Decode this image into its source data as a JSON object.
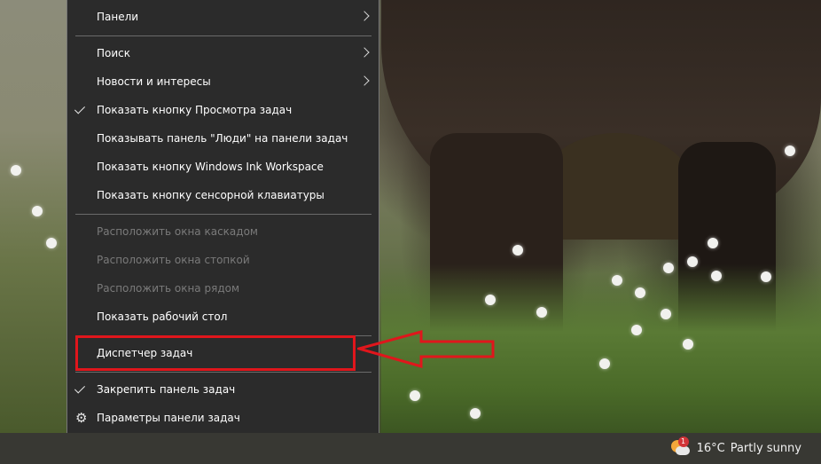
{
  "context_menu": {
    "items": [
      {
        "label": "Панели",
        "submenu": true
      },
      {
        "label": "Поиск",
        "submenu": true
      },
      {
        "label": "Новости и интересы",
        "submenu": true
      },
      {
        "label": "Показать кнопку Просмотра задач",
        "checked": true
      },
      {
        "label": "Показывать панель \"Люди\" на панели задач"
      },
      {
        "label": "Показать кнопку Windows Ink Workspace"
      },
      {
        "label": "Показать кнопку сенсорной клавиатуры"
      },
      {
        "label": "Расположить окна каскадом",
        "disabled": true
      },
      {
        "label": "Расположить окна стопкой",
        "disabled": true
      },
      {
        "label": "Расположить окна рядом",
        "disabled": true
      },
      {
        "label": "Показать рабочий стол"
      },
      {
        "label": "Диспетчер задач",
        "highlighted": true
      },
      {
        "label": "Закрепить панель задач",
        "checked": true
      },
      {
        "label": "Параметры панели задач",
        "icon": "gear-icon"
      }
    ]
  },
  "annotation": {
    "color": "#e0161c",
    "target": "Диспетчер задач"
  },
  "taskbar": {
    "weather": {
      "temperature": "16°C",
      "condition": "Partly sunny",
      "badge": "1",
      "icon": "partly-sunny-icon"
    }
  }
}
